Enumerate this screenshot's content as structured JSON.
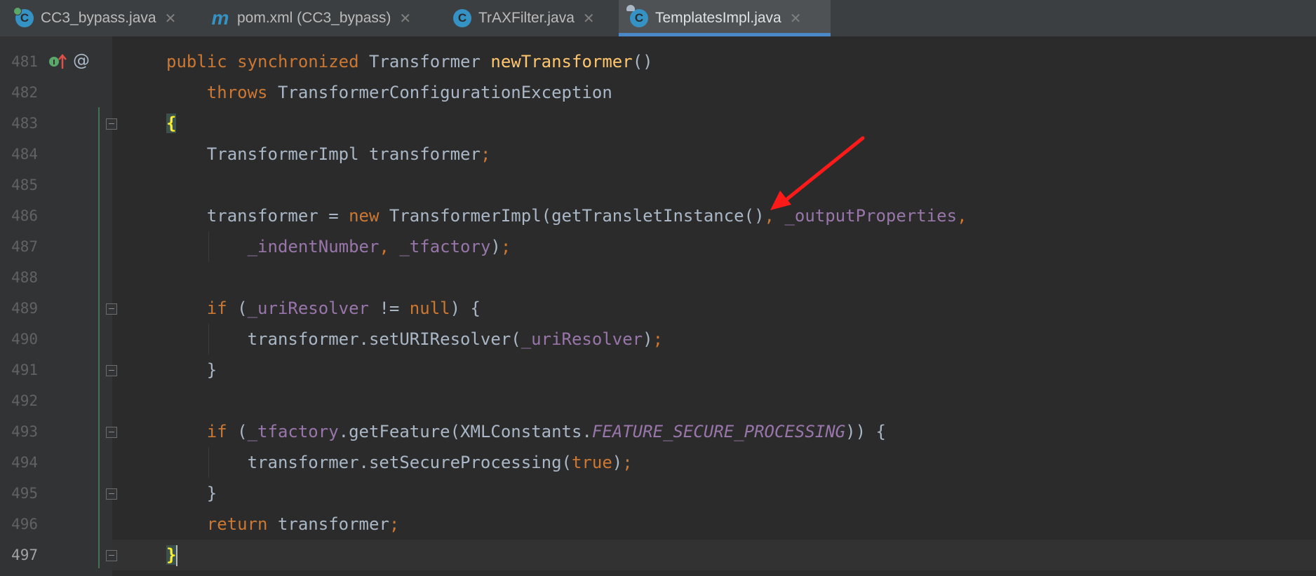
{
  "tabs": [
    {
      "label": "CC3_bypass.java",
      "icon": "java-class-runnable-icon",
      "active": false
    },
    {
      "label": "pom.xml (CC3_bypass)",
      "icon": "maven-icon",
      "active": false
    },
    {
      "label": "TrAXFilter.java",
      "icon": "java-class-icon",
      "active": false
    },
    {
      "label": "TemplatesImpl.java",
      "icon": "java-class-readonly-icon",
      "active": true
    }
  ],
  "close_glyph": "✕",
  "line_numbers": [
    "481",
    "482",
    "483",
    "484",
    "485",
    "486",
    "487",
    "488",
    "489",
    "490",
    "491",
    "492",
    "493",
    "494",
    "495",
    "496",
    "497"
  ],
  "gutter": {
    "line_481_marks": [
      "implementing-method-icon",
      "annotation-at-icon"
    ],
    "at_glyph": "@"
  },
  "code": {
    "l481": {
      "t1": "public",
      "t2": "synchronized",
      "t3": "Transformer",
      "t4": "newTransformer",
      "t5": "()"
    },
    "l482": {
      "t1": "throws",
      "t2": "TransformerConfigurationException"
    },
    "l483": {
      "t1": "{"
    },
    "l484": {
      "t1": "TransformerImpl transformer",
      "t2": ";"
    },
    "l486": {
      "t1": "transformer = ",
      "t2": "new",
      "t3": "TransformerImpl(getTransletInstance()",
      "t4": ",",
      "t5": "_outputProperties",
      "t6": ","
    },
    "l487": {
      "t1": "_indentNumber",
      "t2": ",",
      "t3": "_tfactory",
      "t4": ")",
      "t5": ";"
    },
    "l489": {
      "t1": "if",
      "t2": "(",
      "t3": "_uriResolver",
      "t4": " != ",
      "t5": "null",
      "t6": ") {"
    },
    "l490": {
      "t1": "transformer.setURIResolver(",
      "t2": "_uriResolver",
      "t3": ")",
      "t4": ";"
    },
    "l491": {
      "t1": "}"
    },
    "l493": {
      "t1": "if",
      "t2": "(",
      "t3": "_tfactory",
      "t4": ".getFeature(XMLConstants.",
      "t5": "FEATURE_SECURE_PROCESSING",
      "t6": ")) {"
    },
    "l494": {
      "t1": "transformer.setSecureProcessing(",
      "t2": "true",
      "t3": ")",
      "t4": ";"
    },
    "l495": {
      "t1": "}"
    },
    "l496": {
      "t1": "return",
      "t2": "transformer",
      "t3": ";"
    },
    "l497": {
      "t1": "}"
    }
  },
  "annotation": {
    "type": "red-arrow",
    "points_to": "getTransletInstance()",
    "color": "#ff1a1a"
  },
  "colors": {
    "keyword": "#cc7832",
    "method": "#ffc66d",
    "field": "#9876aa",
    "text": "#a9b7c6",
    "background": "#2b2b2b",
    "active_tab_underline": "#4a88c7"
  }
}
